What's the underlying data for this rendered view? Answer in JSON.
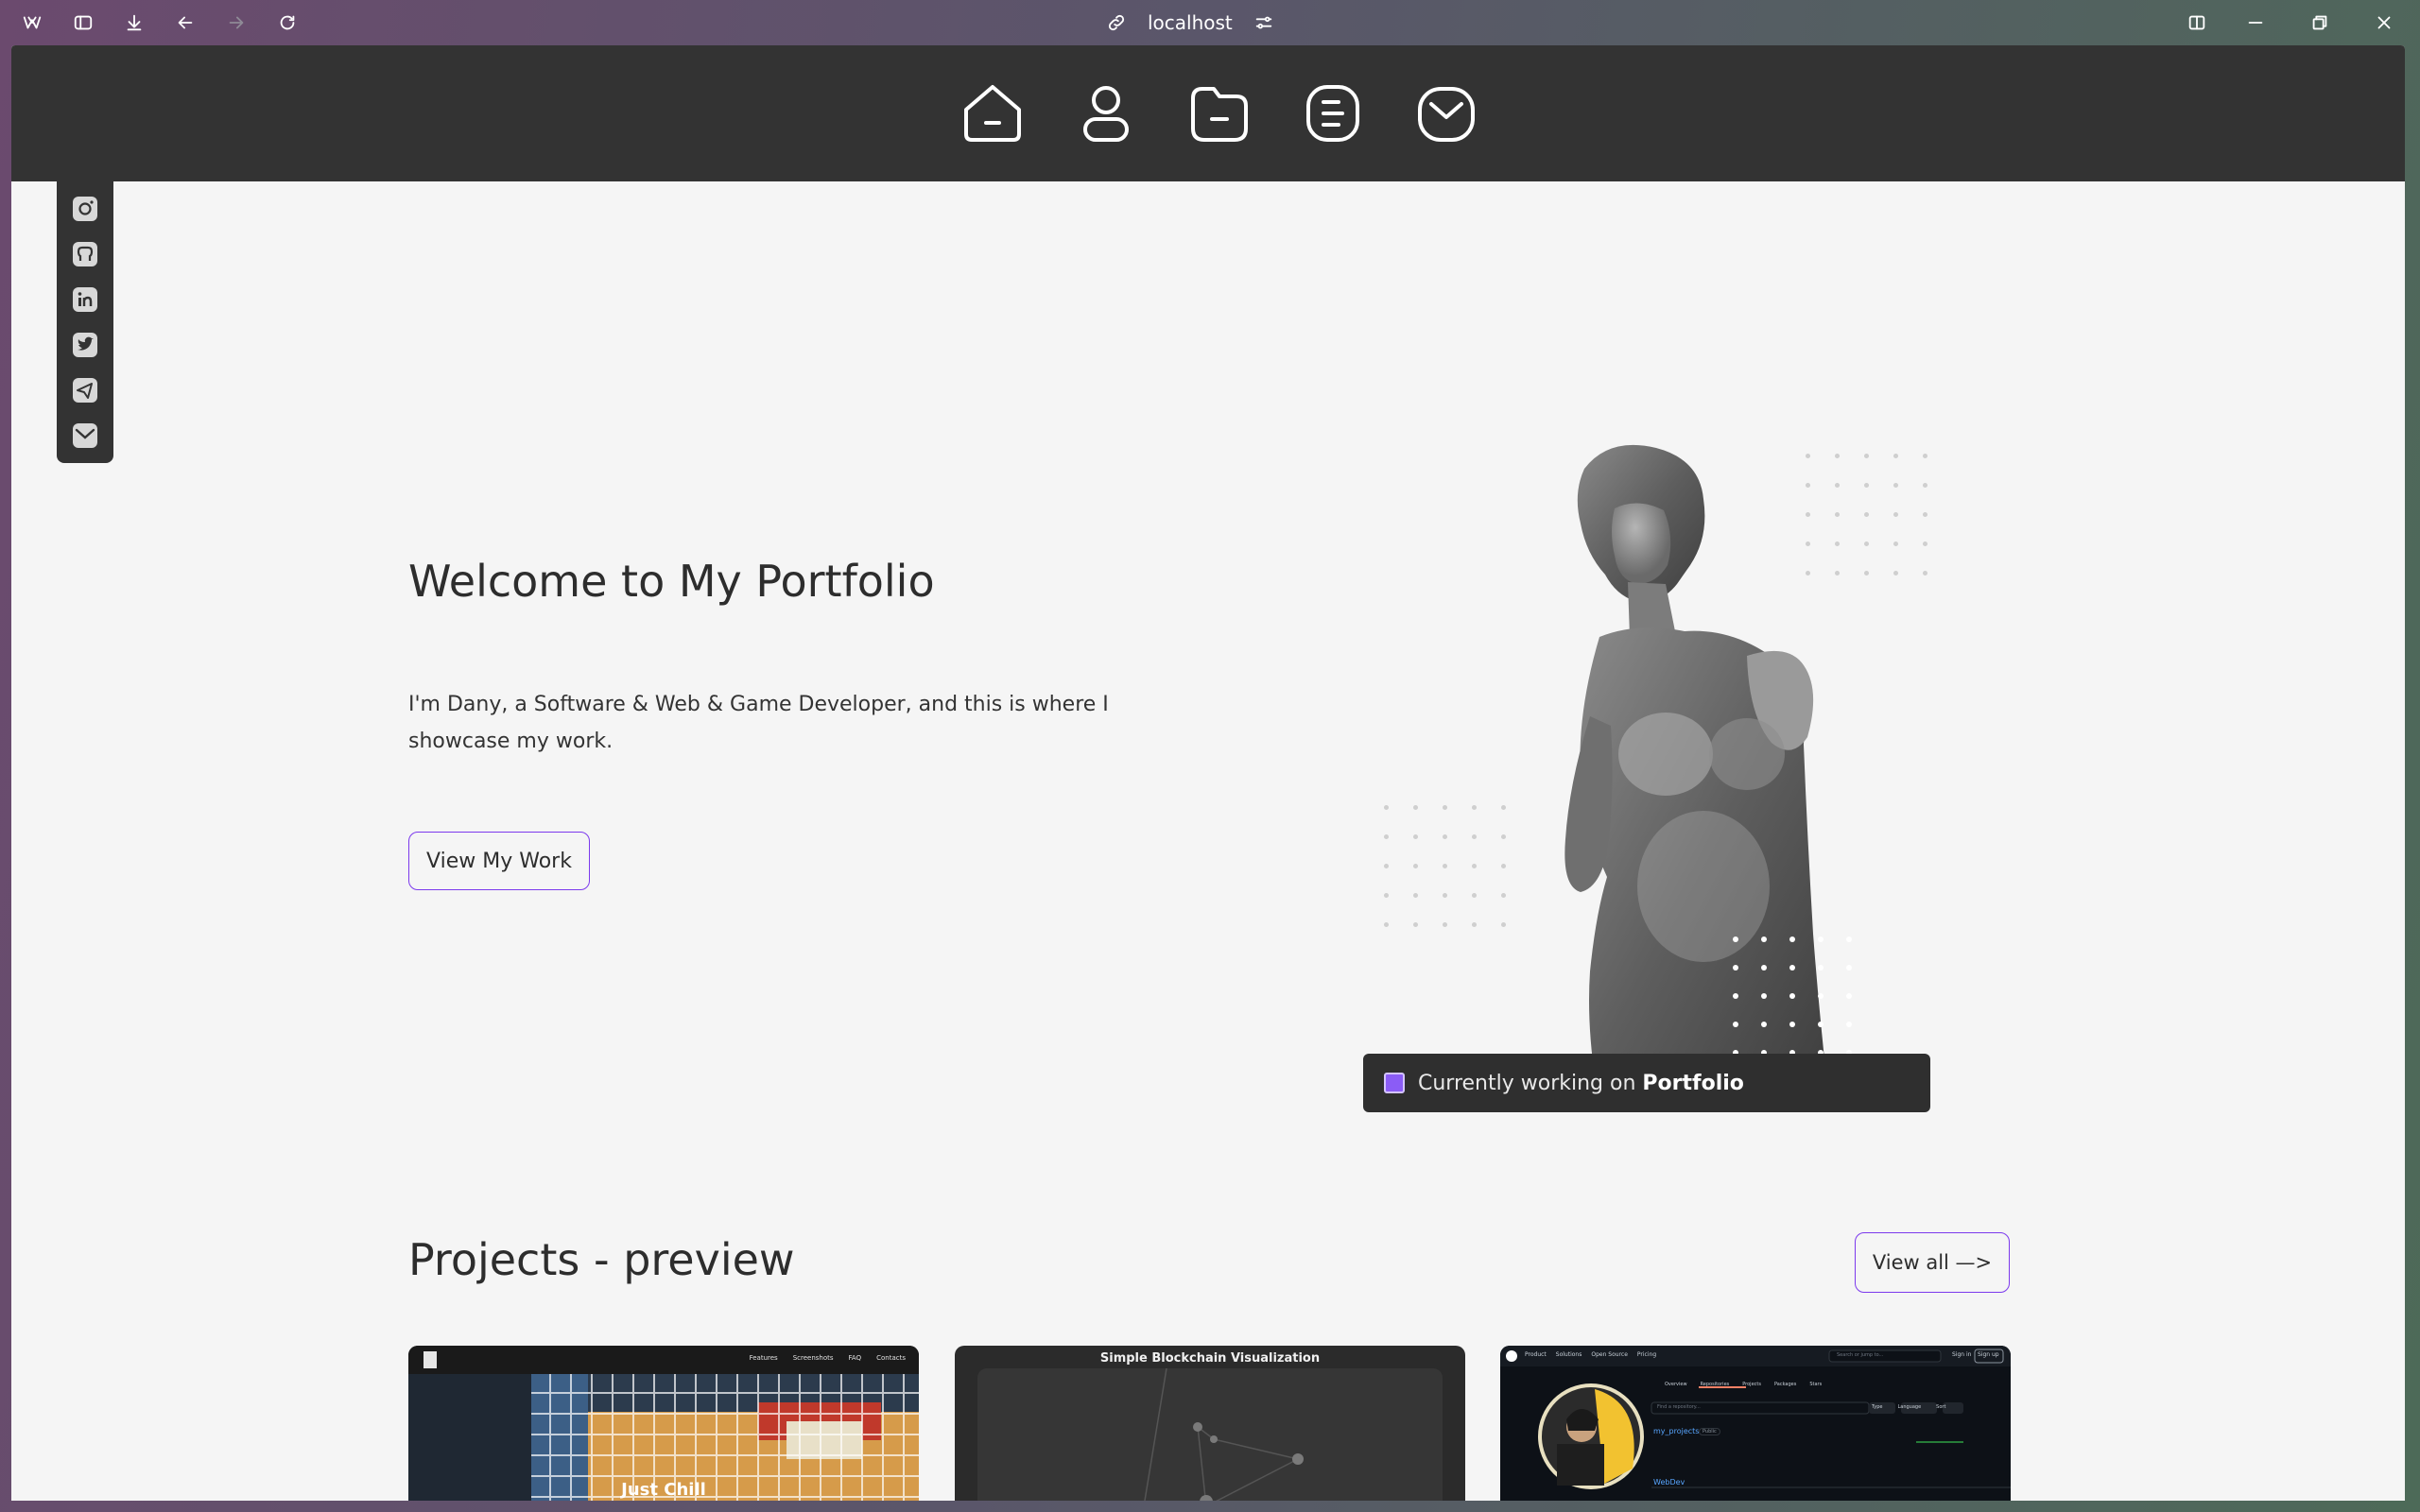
{
  "browser": {
    "address": "localhost"
  },
  "nav": {
    "items": [
      "home",
      "about",
      "projects",
      "blog",
      "contact"
    ]
  },
  "social": {
    "items": [
      "instagram",
      "github",
      "linkedin",
      "twitter",
      "telegram",
      "email"
    ]
  },
  "hero": {
    "title": "Welcome to My Portfolio",
    "subtitle": "I'm Dany, a Software & Web & Game Developer, and this is where I showcase my work.",
    "cta": "View My Work"
  },
  "status": {
    "prefix": "Currently working on",
    "project": "Portfolio",
    "accent": "#8b5cf6"
  },
  "projects": {
    "title": "Projects - preview",
    "view_all": "View all —>",
    "cards": [
      {
        "nav_links": [
          "Features",
          "Screenshots",
          "FAQ",
          "Contacts"
        ],
        "caption": "Just Chill"
      },
      {
        "heading": "Simple Blockchain Visualization"
      },
      {
        "nav_links": [
          "Product",
          "Solutions",
          "Open Source",
          "Pricing"
        ],
        "search_placeholder": "Search or jump to...",
        "sign_in": "Sign in",
        "sign_up": "Sign up",
        "tabs": [
          "Overview",
          "Repositories",
          "Projects",
          "Packages",
          "Stars"
        ],
        "repo_search_placeholder": "Find a repository...",
        "filters": [
          "Type",
          "Language",
          "Sort"
        ],
        "repos": [
          "my_projects",
          "WebDev"
        ],
        "repo_badge": "Public"
      }
    ]
  },
  "colors": {
    "nav_bg": "#333333",
    "page_bg": "#f5f5f5",
    "button_border": "#7c3aed"
  }
}
